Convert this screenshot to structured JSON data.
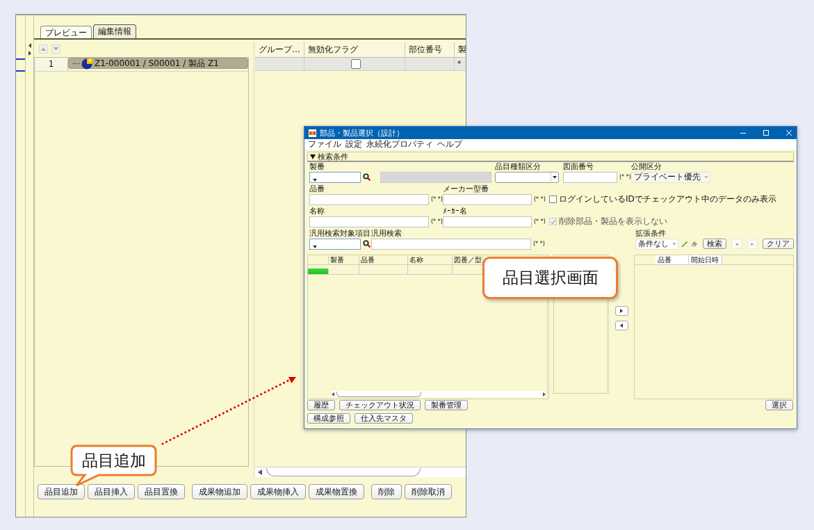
{
  "main_window": {
    "tabs": [
      {
        "label": "プレビュー",
        "selected": false
      },
      {
        "label": "編集情報",
        "selected": true
      }
    ],
    "tree": {
      "rows": [
        {
          "number": "1",
          "label": "Z1-000001 / S00001 / 製品 Z1",
          "selected": true
        }
      ]
    },
    "grid": {
      "columns": [
        "グループ…",
        "無効化フラグ",
        "部位番号",
        "製"
      ],
      "rows": [
        {
          "invalidated": false,
          "column_4": "*"
        }
      ]
    },
    "button_groups": [
      [
        "品目追加",
        "品目挿入",
        "品目置換"
      ],
      [
        "成果物追加",
        "成果物挿入",
        "成果物置換"
      ],
      [
        "削除",
        "削除取消"
      ]
    ]
  },
  "selection_dialog": {
    "title": "部品・製品選択（設計）",
    "menu": [
      "ファイル",
      "設定",
      "永続化プロパティ",
      "ヘルプ"
    ],
    "section": {
      "label": "検索条件",
      "expanded": true
    },
    "search_rows": [
      [
        {
          "kind": "combo_search",
          "label": "製番"
        },
        {
          "kind": "readonly"
        },
        {
          "kind": "select",
          "label": "品目種類区分",
          "disabled": false
        },
        {
          "kind": "text",
          "label": "図面番号",
          "suffix": "(* *)"
        },
        {
          "kind": "select",
          "label": "公開区分",
          "value": "プライベート優先",
          "disabled": true
        }
      ],
      [
        {
          "kind": "text",
          "label": "品番",
          "suffix": "(* *)"
        },
        {
          "kind": "text",
          "label": "メーカー型番",
          "suffix": "(* *)"
        },
        {
          "kind": "checkbox",
          "label": "ログインしているIDでチェックアウト中のデータのみ表示",
          "checked": false,
          "disabled": false
        }
      ],
      [
        {
          "kind": "text",
          "label": "名称",
          "suffix": "(* *)"
        },
        {
          "kind": "text",
          "label": "ﾒｰｶｰ名",
          "suffix": "(* *)"
        },
        {
          "kind": "checkbox",
          "label": "削除部品・製品を表示しない",
          "checked": true,
          "disabled": true
        }
      ],
      [
        {
          "kind": "combo_search",
          "label": "汎用検索対象項目"
        },
        {
          "kind": "text",
          "label": "汎用検索",
          "suffix": "(* *)"
        },
        {
          "kind": "ext",
          "label": "拡張条件",
          "value": "条件なし"
        }
      ]
    ],
    "search_buttons": [
      {
        "label": "検索",
        "disabled": false
      },
      {
        "label": "◂",
        "disabled": true
      },
      {
        "label": "▸",
        "disabled": true
      },
      {
        "label": "クリア",
        "disabled": false
      }
    ],
    "results_table": {
      "columns": [
        "製番",
        "品番",
        "名称",
        "図番／型"
      ]
    },
    "selected_table": {
      "columns": [
        "品番",
        "開始日時"
      ]
    },
    "action_button_rows": [
      [
        "履歴",
        "チェックアウト状況",
        "製番管理"
      ],
      [
        "構成参照",
        "仕入先マスタ"
      ]
    ],
    "confirm_button": "選択"
  },
  "callouts": [
    {
      "text": "品目選択画面"
    },
    {
      "text": "品目追加"
    }
  ]
}
